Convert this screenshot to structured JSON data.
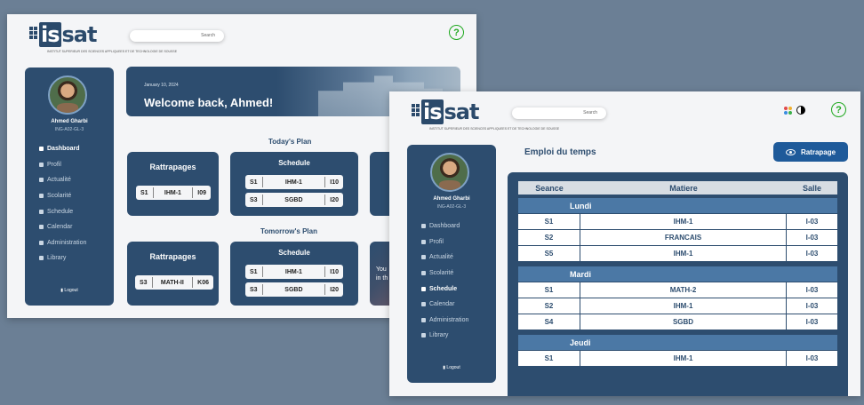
{
  "brand": {
    "name": "sat",
    "is": "is",
    "small": "SOUSSE",
    "tagline": "INSTITUT SUPERIEUR DES SCIENCES APPLIQUEES ET DE TECHNOLOGIE DE SOUSSE"
  },
  "search": {
    "placeholder": "Search"
  },
  "user": {
    "name": "Ahmed Gharbi",
    "code": "ING-A02-GL-3"
  },
  "nav": {
    "items": [
      "Dashboard",
      "Profil",
      "Actualité",
      "Scolarité",
      "Schedule",
      "Calendar",
      "Administration",
      "Library"
    ],
    "logout": "Logout"
  },
  "dashboard": {
    "date": "January 10, 2024",
    "welcome": "Welcome back, Ahmed!",
    "today_title": "Today's Plan",
    "tomorrow_title": "Tomorrow's Plan",
    "rattrapages_label": "Rattrapages",
    "schedule_label": "Schedule",
    "today_rattrapage": [
      "S1",
      "IHM-1",
      "I09"
    ],
    "today_schedule": [
      [
        "S1",
        "IHM-1",
        "I10"
      ],
      [
        "S3",
        "SGBD",
        "I20"
      ]
    ],
    "tomorrow_rattrapage": [
      "S3",
      "MATH-II",
      "K06"
    ],
    "tomorrow_schedule": [
      [
        "S1",
        "IHM-1",
        "I10"
      ],
      [
        "S3",
        "SGBD",
        "I20"
      ]
    ],
    "partial_card_text": [
      "You",
      "in th"
    ]
  },
  "timetable": {
    "title": "Emploi du temps",
    "rattrapage_button": "Ratrapage",
    "headers": [
      "Seance",
      "Matiere",
      "Salle"
    ],
    "days": [
      {
        "name": "Lundi",
        "rows": [
          [
            "S1",
            "IHM-1",
            "I-03"
          ],
          [
            "S2",
            "FRANCAIS",
            "I-03"
          ],
          [
            "S5",
            "IHM-1",
            "I-03"
          ]
        ]
      },
      {
        "name": "Mardi",
        "rows": [
          [
            "S1",
            "MATH-2",
            "I-03"
          ],
          [
            "S2",
            "IHM-1",
            "I-03"
          ],
          [
            "S4",
            "SGBD",
            "I-03"
          ]
        ]
      },
      {
        "name": "Jeudi",
        "rows": [
          [
            "S1",
            "IHM-1",
            "I-03"
          ]
        ]
      }
    ]
  },
  "colors": {
    "primary": "#2d4d6f",
    "accent": "#1e5a9a",
    "day_row": "#4b78a5",
    "help": "#1ea81e"
  }
}
